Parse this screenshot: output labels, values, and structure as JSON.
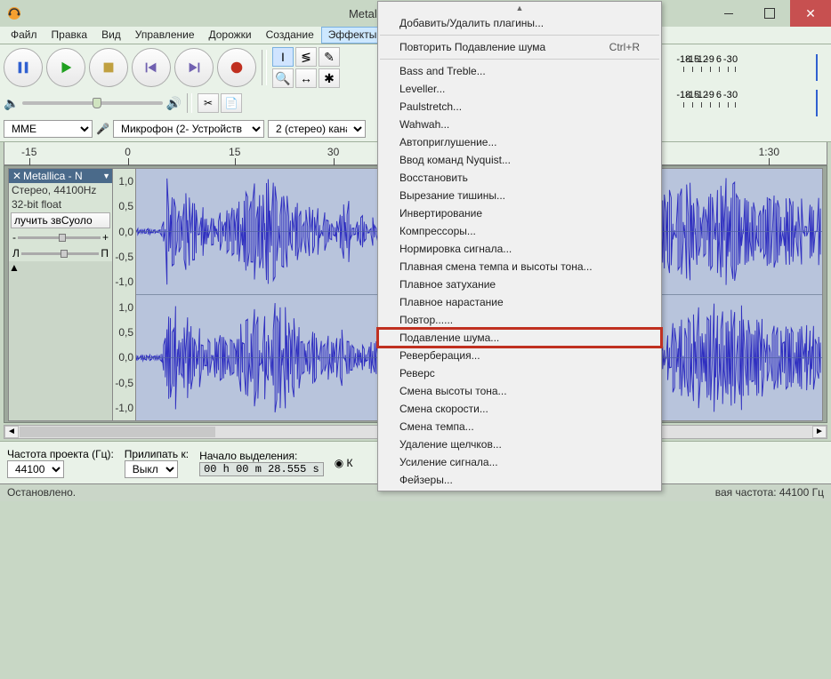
{
  "title": "Metallic",
  "menubar": [
    "Файл",
    "Правка",
    "Вид",
    "Управление",
    "Дорожки",
    "Создание",
    "Эффекты"
  ],
  "active_menu_index": 6,
  "devices": {
    "host": "MME",
    "input": "Микрофон (2- Устройств",
    "channels": "2 (стерео) кана"
  },
  "timeline_labels": [
    {
      "pos": 0.03,
      "text": "-15"
    },
    {
      "pos": 0.15,
      "text": "0"
    },
    {
      "pos": 0.28,
      "text": "15"
    },
    {
      "pos": 0.4,
      "text": "30"
    },
    {
      "pos": 0.93,
      "text": "1:30"
    }
  ],
  "track": {
    "name": "Metallica - N",
    "format": "Стерео, 44100Hz",
    "depth": "32-bit float",
    "solo": "лучить звСуоло"
  },
  "amp_labels": [
    "1,0",
    "0,5",
    "0,0",
    "-0,5",
    "-1,0",
    "1,0",
    "0,5",
    "0,0",
    "-0,5",
    "-1,0"
  ],
  "db_labels_left": [
    {
      "pos": 0.02,
      "t": "-18"
    },
    {
      "pos": 0.08,
      "t": "-15"
    },
    {
      "pos": 0.14,
      "t": "-12"
    },
    {
      "pos": 0.2,
      "t": "-9"
    },
    {
      "pos": 0.26,
      "t": "6"
    },
    {
      "pos": 0.32,
      "t": "-3"
    },
    {
      "pos": 0.37,
      "t": "0"
    }
  ],
  "db_labels_right": [
    {
      "pos": 0.02,
      "t": "-18"
    },
    {
      "pos": 0.08,
      "t": "-15"
    },
    {
      "pos": 0.14,
      "t": "-12"
    },
    {
      "pos": 0.2,
      "t": "-9"
    },
    {
      "pos": 0.26,
      "t": "6"
    },
    {
      "pos": 0.32,
      "t": "-3"
    },
    {
      "pos": 0.37,
      "t": "0"
    }
  ],
  "bottom": {
    "rate_label": "Частота проекта (Гц):",
    "rate": "44100",
    "snap_label": "Прилипать к:",
    "snap": "Выкл",
    "sel_label": "Начало выделения:",
    "time": "00 h 00 m 28.555 s",
    "radio": "К"
  },
  "status_left": "Остановлено.",
  "status_right": "вая частота: 44100 Гц",
  "menu_items": [
    {
      "t": "Добавить/Удалить плагины..."
    },
    {
      "sep": true
    },
    {
      "t": "Повторить Подавление шума",
      "sc": "Ctrl+R"
    },
    {
      "sep": true
    },
    {
      "t": "Bass and Treble..."
    },
    {
      "t": "Leveller..."
    },
    {
      "t": "Paulstretch..."
    },
    {
      "t": "Wahwah..."
    },
    {
      "t": "Автоприглушение..."
    },
    {
      "t": "Ввод команд Nyquist..."
    },
    {
      "t": "Восстановить"
    },
    {
      "t": "Вырезание тишины..."
    },
    {
      "t": "Инвертирование"
    },
    {
      "t": "Компрессоры..."
    },
    {
      "t": "Нормировка сигнала..."
    },
    {
      "t": "Плавная смена темпа и высоты тона..."
    },
    {
      "t": "Плавное затухание"
    },
    {
      "t": "Плавное нарастание"
    },
    {
      "t": "Повтор......"
    },
    {
      "t": "Подавление шума...",
      "hl": true
    },
    {
      "t": "Реверберация..."
    },
    {
      "t": "Реверс"
    },
    {
      "t": "Смена высоты тона..."
    },
    {
      "t": "Смена скорости..."
    },
    {
      "t": "Смена темпа..."
    },
    {
      "t": "Удаление щелчков..."
    },
    {
      "t": "Усиление сигнала..."
    },
    {
      "t": "Фейзеры..."
    }
  ]
}
